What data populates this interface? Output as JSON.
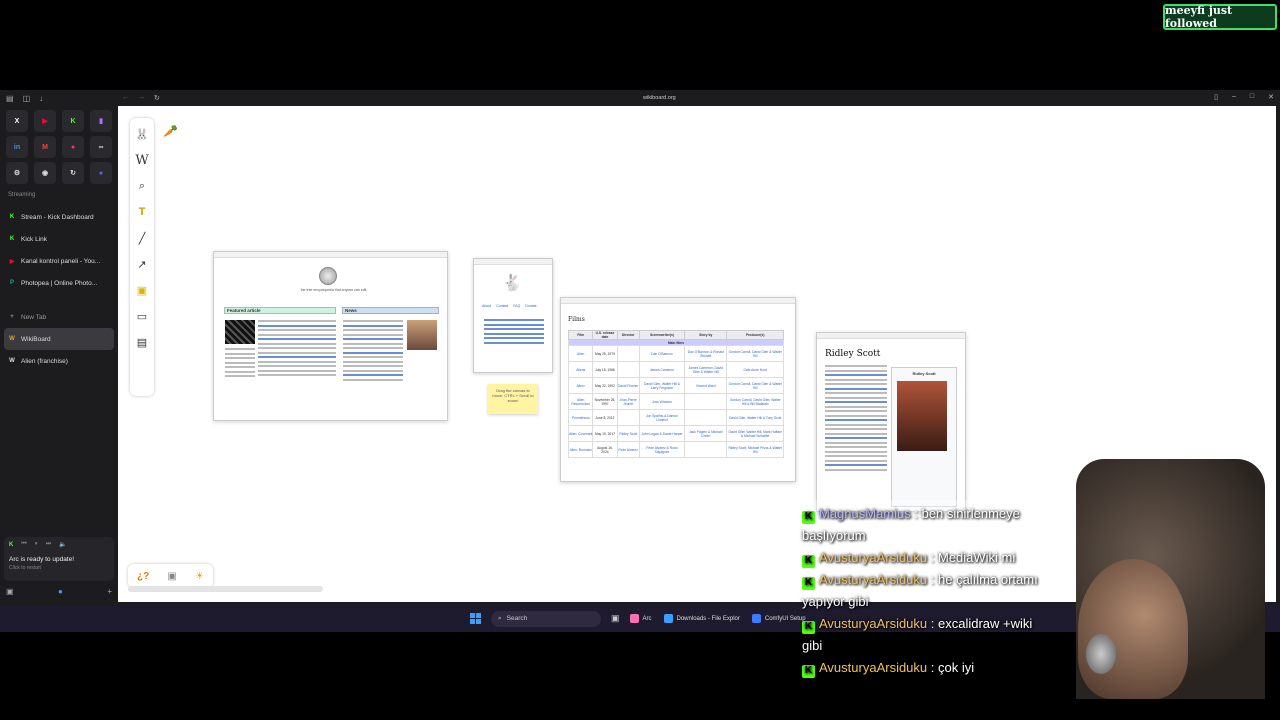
{
  "alert": {
    "text": "meeyfi just followed"
  },
  "browser": {
    "url": "wikiboard.org",
    "favorites": [
      {
        "icon": "x-icon",
        "label": "X",
        "color": "#ffffff"
      },
      {
        "icon": "youtube-icon",
        "label": "▶",
        "color": "#ff0033"
      },
      {
        "icon": "kick-icon",
        "label": "K",
        "color": "#53fc18"
      },
      {
        "icon": "twitch-icon",
        "label": "▮",
        "color": "#a970ff"
      },
      {
        "icon": "linkedin-icon",
        "label": "in",
        "color": "#3a8ddd"
      },
      {
        "icon": "gmail-icon",
        "label": "M",
        "color": "#ea4335"
      },
      {
        "icon": "record-icon",
        "label": "●",
        "color": "#ff3366"
      },
      {
        "icon": "app-icon",
        "label": "∞",
        "color": "#cccccc"
      },
      {
        "icon": "settings-icon",
        "label": "⚙",
        "color": "#dddddd"
      },
      {
        "icon": "circle-icon",
        "label": "◉",
        "color": "#dddddd"
      },
      {
        "icon": "sync-icon",
        "label": "↻",
        "color": "#dddddd"
      },
      {
        "icon": "discord-icon",
        "label": "●",
        "color": "#5865f2"
      }
    ],
    "section_label": "Streaming",
    "pinned_tabs": [
      {
        "label": "Stream - Kick Dashboard",
        "icon": "kick-icon",
        "color": "#53fc18",
        "glyph": "K"
      },
      {
        "label": "Kick Link",
        "icon": "kick-icon",
        "color": "#53fc18",
        "glyph": "K"
      },
      {
        "label": "Kanal kontrol paneli - You...",
        "icon": "youtube-icon",
        "color": "#ff0033",
        "glyph": "▶"
      },
      {
        "label": "Photopea | Online Photo...",
        "icon": "photopea-icon",
        "color": "#18a497",
        "glyph": "P"
      }
    ],
    "new_tab_label": "New Tab",
    "tabs": [
      {
        "label": "WikiBoard",
        "icon": "wikiboard-icon",
        "color": "#f0a020",
        "glyph": "W",
        "active": true
      },
      {
        "label": "Alien (franchise)",
        "icon": "wikipedia-icon",
        "color": "#dddddd",
        "glyph": "W",
        "active": false
      }
    ],
    "update": {
      "title": "Arc is ready to update!",
      "subtitle": "Click to restart"
    }
  },
  "canvas": {
    "wiki_main": {
      "welcome": "the free encyclopedia that anyone can edit.",
      "featured_title": "Featured article",
      "news_title": "News"
    },
    "wiki_logo_links": [
      "About",
      "Contact",
      "FAQ",
      "Donate"
    ],
    "sticky_note": "Drag the canvas to move, CTRL + Scroll to zoom!",
    "films": {
      "heading": "Films",
      "columns": [
        "Film",
        "U.S. release date",
        "Director",
        "Screenwriter(s)",
        "Story by",
        "Producer(s)"
      ],
      "section": "Main films",
      "rows": [
        [
          "Alien",
          "May 25, 1979",
          "",
          "Dan O'Bannon",
          "Dan O'Bannon & Ronald Shusett",
          "Gordon Carroll, David Giler & Walter Hill"
        ],
        [
          "Aliens",
          "July 18, 1986",
          "",
          "James Cameron",
          "James Cameron, David Giler & Walter Hill",
          "Gale Anne Hurd"
        ],
        [
          "Alien³",
          "May 22, 1992",
          "David Fincher",
          "David Giler, Walter Hill & Larry Ferguson",
          "Vincent Ward",
          "Gordon Carroll, David Giler & Walter Hill"
        ],
        [
          "Alien Resurrection",
          "November 26, 1997",
          "Jean-Pierre Jeunet",
          "Joss Whedon",
          "",
          "Gordon Carroll, David Giler, Walter Hill & Bill Badalato"
        ],
        [
          "Prometheus",
          "June 8, 2012",
          "",
          "Jon Spaihts & Damon Lindelof",
          "",
          "David Giler, Walter Hill & Tony Scott"
        ],
        [
          "Alien: Covenant",
          "May 19, 2017",
          "Ridley Scott",
          "John Logan & Dante Harper",
          "Jack Paglen & Michael Green",
          "David Giler, Walter Hill, Mark Huffam & Michael Schaefer"
        ],
        [
          "Alien: Romulus",
          "August 16, 2024",
          "Fede Álvarez",
          "Fede Álvarez & Rodo Sayagues",
          "",
          "Ridley Scott, Michael Pruss & Walter Hill"
        ]
      ]
    },
    "ridley": {
      "name": "Ridley Scott",
      "caption": "Ridley Scott"
    }
  },
  "taskbar": {
    "search": "Search",
    "apps": [
      {
        "label": "Arc",
        "icon": "arc-icon",
        "color": "#ff6fb5"
      },
      {
        "label": "Downloads - File Explor",
        "icon": "download-icon",
        "color": "#3aa0ff"
      },
      {
        "label": "ComfyUI Setup",
        "icon": "comfy-icon",
        "color": "#3a7bff"
      }
    ]
  },
  "chat": [
    {
      "user": "MagnusMamius",
      "text": " : ben sinirlenmeye başlıyorum",
      "badge": "K"
    },
    {
      "user": "AvusturyaArsiduku",
      "text": " : MediaWiki mi",
      "badge": "K"
    },
    {
      "user": "AvusturyaArsiduku",
      "text": " : he çalılma ortamı yapıyor gibi",
      "badge": "K"
    },
    {
      "user": "AvusturyaArsiduku",
      "text": " : excalidraw +wiki gibi",
      "badge": "K"
    },
    {
      "user": "AvusturyaArsiduku",
      "text": " : çok iyi",
      "badge": "K"
    }
  ]
}
